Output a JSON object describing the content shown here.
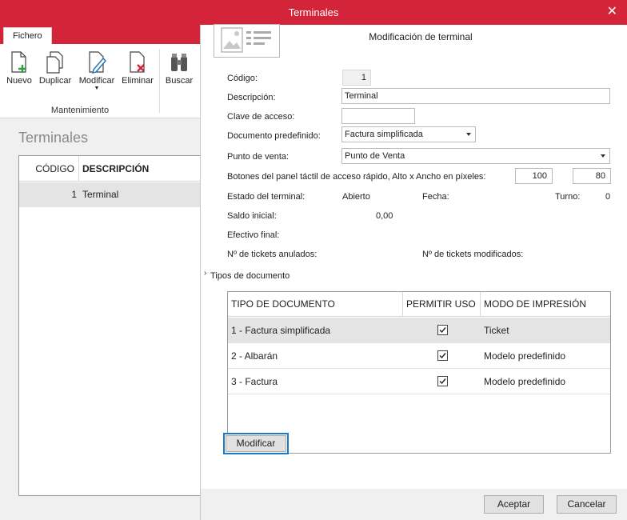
{
  "window": {
    "title": "Terminales"
  },
  "ribbon": {
    "tab": "Fichero",
    "buttons": [
      {
        "label": "Nuevo",
        "icon": "new-document-icon"
      },
      {
        "label": "Duplicar",
        "icon": "duplicate-icon"
      },
      {
        "label": "Modificar",
        "icon": "edit-document-icon"
      },
      {
        "label": "Eliminar",
        "icon": "delete-document-icon"
      },
      {
        "label": "Buscar",
        "icon": "binoculars-icon"
      }
    ],
    "group_label": "Mantenimiento"
  },
  "list": {
    "title": "Terminales",
    "columns": [
      "CÓDIGO",
      "DESCRIPCIÓN"
    ],
    "rows": [
      {
        "code": "1",
        "description": "Terminal"
      }
    ]
  },
  "dialog": {
    "heading": "Modificación de terminal",
    "fields": {
      "codigo": {
        "label": "Código:",
        "value": "1"
      },
      "descripcion": {
        "label": "Descripción:",
        "value": "Terminal"
      },
      "clave": {
        "label": "Clave de acceso:",
        "value": ""
      },
      "documento": {
        "label": "Documento predefinido:",
        "value": "Factura simplificada"
      },
      "punto_venta": {
        "label": "Punto de venta:",
        "value": "Punto de Venta"
      },
      "botones": {
        "label": "Botones del panel táctil de acceso rápido, Alto x Ancho en píxeles:",
        "alto": "100",
        "ancho": "80"
      },
      "estado": {
        "label": "Estado del terminal:",
        "value": "Abierto"
      },
      "fecha": {
        "label": "Fecha:",
        "value": ""
      },
      "turno": {
        "label": "Turno:",
        "value": "0"
      },
      "saldo": {
        "label": "Saldo inicial:",
        "value": "0,00"
      },
      "efectivo": {
        "label": "Efectivo final:",
        "value": ""
      },
      "anulados": {
        "label": "Nº de tickets anulados:"
      },
      "modificados": {
        "label": "Nº de tickets modificados:"
      }
    },
    "section": {
      "label": "Tipos de documento"
    },
    "grid": {
      "columns": [
        "TIPO DE DOCUMENTO",
        "PERMITIR USO",
        "MODO DE IMPRESIÓN"
      ],
      "rows": [
        {
          "tipo": "1 - Factura simplificada",
          "permitir": true,
          "modo": "Ticket"
        },
        {
          "tipo": "2 - Albarán",
          "permitir": true,
          "modo": "Modelo predefinido"
        },
        {
          "tipo": "3 - Factura",
          "permitir": true,
          "modo": "Modelo predefinido"
        }
      ]
    },
    "modify_button": "Modificar",
    "accept_button": "Aceptar",
    "cancel_button": "Cancelar"
  }
}
